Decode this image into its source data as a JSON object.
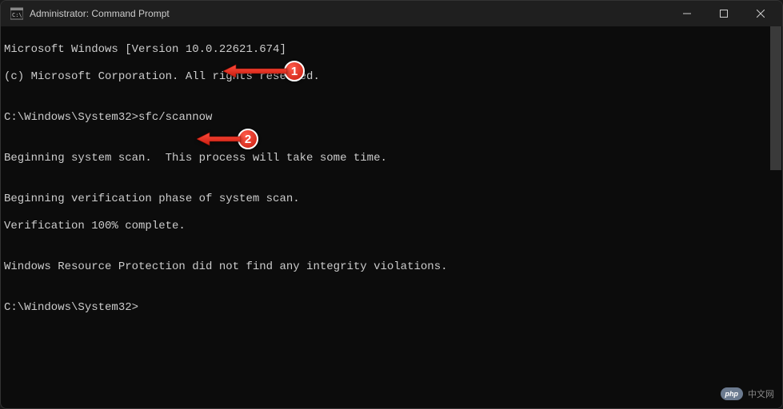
{
  "window": {
    "title": "Administrator: Command Prompt"
  },
  "terminal": {
    "line1": "Microsoft Windows [Version 10.0.22621.674]",
    "line2": "(c) Microsoft Corporation. All rights reserved.",
    "blank1": "",
    "prompt1_path": "C:\\Windows\\System32>",
    "prompt1_cmd": "sfc/scannow",
    "blank2": "",
    "line3": "Beginning system scan.  This process will take some time.",
    "blank3": "",
    "line4": "Beginning verification phase of system scan.",
    "line5": "Verification 100% complete.",
    "blank4": "",
    "line6": "Windows Resource Protection did not find any integrity violations.",
    "blank5": "",
    "prompt2_path": "C:\\Windows\\System32>",
    "prompt2_cmd": ""
  },
  "annotations": {
    "badge1": "1",
    "badge2": "2"
  },
  "watermark": {
    "logo": "php",
    "text": "中文网"
  }
}
